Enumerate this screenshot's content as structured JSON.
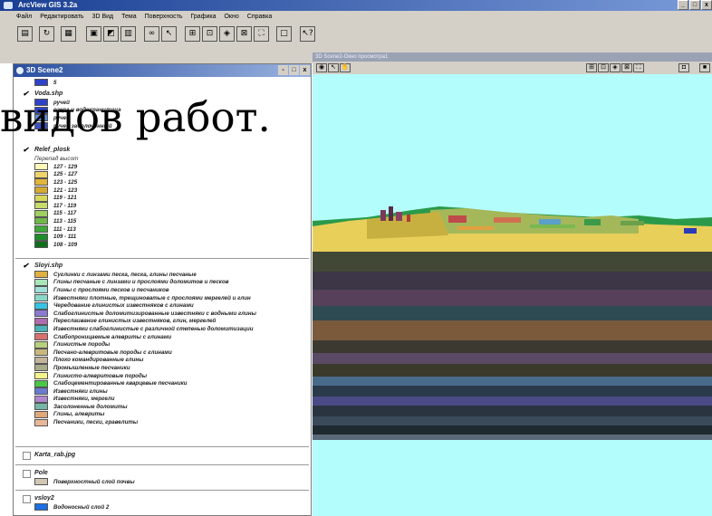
{
  "app": {
    "title": "ArcView GIS 3.2a"
  },
  "menu": [
    "Файл",
    "Редактировать",
    "3D Вид",
    "Тема",
    "Поверхность",
    "Графика",
    "Окно",
    "Справка"
  ],
  "window_controls": [
    "_",
    "□",
    "x"
  ],
  "toolbar_icons": [
    "save-icon",
    "refresh-icon",
    "table-icon",
    "layer-props-icon",
    "edit-legend-icon",
    "binoculars-icon",
    "cursor-icon",
    "zoom-extent-icon",
    "zoom-active-icon",
    "zoom-in-icon",
    "zoom-out-icon",
    "blank-icon",
    "help-icon"
  ],
  "toc": {
    "title": "3D Scene2",
    "controls": [
      "-",
      "□",
      "x"
    ],
    "layers": [
      {
        "name": "Voda.shp",
        "checked": true,
        "items": [
          {
            "label": "ручей",
            "color": "#2e42c8"
          },
          {
            "label": "озера и водохранилища",
            "color": "#2e42c8"
          },
          {
            "label": "ручей",
            "color": "#5b8de0"
          },
          {
            "label": "ручей заболоченный",
            "color": "#3a4fc0"
          }
        ]
      },
      {
        "name": "Relef_plosk",
        "checked": true,
        "sublabel": "Перепад высот",
        "items": [
          {
            "label": "127 - 129",
            "color": "#fff8b8"
          },
          {
            "label": "125 - 127",
            "color": "#f0d46a"
          },
          {
            "label": "123 - 125",
            "color": "#e2b53a"
          },
          {
            "label": "121 - 123",
            "color": "#d6aa30"
          },
          {
            "label": "119 - 121",
            "color": "#d8d85a"
          },
          {
            "label": "117 - 119",
            "color": "#c8dc6a"
          },
          {
            "label": "115 - 117",
            "color": "#9fd060"
          },
          {
            "label": "113 - 115",
            "color": "#70b848"
          },
          {
            "label": "111 - 113",
            "color": "#3fa83a"
          },
          {
            "label": "109 - 111",
            "color": "#1f8c2a"
          },
          {
            "label": "108 - 109",
            "color": "#0e6e1c"
          }
        ]
      },
      {
        "name": "Sloyi.shp",
        "checked": true,
        "items": [
          {
            "label": "Суглинки с линзами песка, песка, глины песчаные",
            "color": "#e2b040"
          },
          {
            "label": "Глины песчаные с линзами и прослоями доломитов и песков",
            "color": "#a8e6b8"
          },
          {
            "label": "Глины с прослоями песков и песчаников",
            "color": "#9fe0d8"
          },
          {
            "label": "Известняки плотные, трещиноватые с прослоями мергелей и глин",
            "color": "#88d8c8"
          },
          {
            "label": "Чередование глинистых известняков с глинами",
            "color": "#36c4e4"
          },
          {
            "label": "Слабоглинистые доломитизированные известняки с водными глины",
            "color": "#8a7bd0"
          },
          {
            "label": "Переслаивание глинистых известняков, глин, мергелей",
            "color": "#b06ab0"
          },
          {
            "label": "Известняки слабоглинистые с различной степенью доломитизации",
            "color": "#4ab2b8"
          },
          {
            "label": "Слабопроницаемые алевриты с глинами",
            "color": "#d87070"
          },
          {
            "label": "Глинистые породы",
            "color": "#b8d07a"
          },
          {
            "label": "Песчано-алевритовые породы с глинами",
            "color": "#c8b87e"
          },
          {
            "label": "Плохо командированные глины",
            "color": "#c0b49a"
          },
          {
            "label": "Промышленные песчаники",
            "color": "#a8aa88"
          },
          {
            "label": "Глинисто-алевритовые породы",
            "color": "#f4f48a"
          },
          {
            "label": "Слабоцементированные кварцевые песчаники",
            "color": "#48c848"
          },
          {
            "label": "Известняки глины",
            "color": "#6a7ad0"
          },
          {
            "label": "Известняки, мергели",
            "color": "#b088d0"
          },
          {
            "label": "Засолоненные доломиты",
            "color": "#76b6a8"
          },
          {
            "label": "Глины, алевриты",
            "color": "#e0a878"
          },
          {
            "label": "Песчаники, пески, гравелиты",
            "color": "#e8b898"
          }
        ]
      },
      {
        "name": "Karta_rab.jpg",
        "checked": false,
        "items": []
      },
      {
        "name": "Pole",
        "checked": false,
        "items": [
          {
            "label": "Поверхностный слой почвы",
            "color": "#cfc7b4"
          }
        ]
      },
      {
        "name": "vsloy2",
        "checked": false,
        "items": [
          {
            "label": "Водоносный слой 2",
            "color": "#1b6fe0"
          }
        ]
      }
    ]
  },
  "scene": {
    "title": "3D Scene2-Окно просмотра1",
    "tool_icons": [
      "navigate-icon",
      "zoom-tool-icon",
      "pan-tool-icon"
    ],
    "view_icons": [
      "full-extent-icon",
      "zoom-layer-icon",
      "zoom-active-icon",
      "zoom-in-icon",
      "zoom-out-icon",
      "camera-icon",
      "settings-icon"
    ]
  },
  "overlay_text": "видов работ.",
  "colors": {
    "sky": "#b4fdfd",
    "title_bar": "#1a3f93",
    "chrome": "#d4d0c8"
  }
}
